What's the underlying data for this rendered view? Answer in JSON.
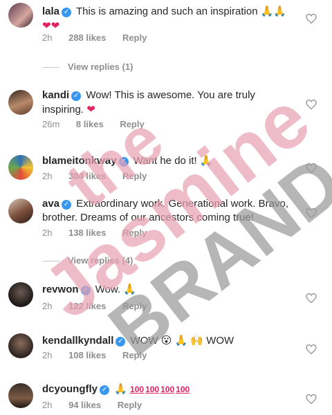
{
  "comments": [
    {
      "username": "lala",
      "text": "This is amazing and such an inspiration",
      "time": "2h",
      "likes": "288 likes",
      "reply": "Reply",
      "emoji": "🙏🙏 ❤❤"
    },
    {
      "username": "kandi",
      "text": "Wow! This is awesome. You are truly inspiring.",
      "time": "26m",
      "likes": "8 likes",
      "reply": "Reply",
      "emoji": "❤"
    },
    {
      "username": "blameitonkway",
      "text": "Want he do it!",
      "time": "2h",
      "likes": "384 likes",
      "reply": "Reply",
      "emoji": "🙏"
    },
    {
      "username": "ava",
      "text": "Extraordinary work. Generational work. Bravo, brother. Dreams of our ancestors coming true!",
      "time": "2h",
      "likes": "138 likes",
      "reply": "Reply"
    },
    {
      "username": "revwon",
      "text": "Wow.",
      "time": "2h",
      "likes": "122 likes",
      "reply": "Reply",
      "emoji": "🙏"
    },
    {
      "username": "kendallkyndall",
      "text": "WOW",
      "text2": "WOW",
      "time": "2h",
      "likes": "108 likes",
      "reply": "Reply",
      "emoji": "😮 🙏 🙌"
    },
    {
      "username": "dcyoungfly",
      "text": "",
      "time": "2h",
      "likes": "94 likes",
      "reply": "Reply",
      "emoji": "🙏 💯💯💯💯"
    }
  ],
  "view_replies": [
    "View replies (1)",
    "View replies (4)"
  ],
  "watermark": {
    "line1": "the",
    "line2": "Jasmine",
    "line3": "BRAND"
  },
  "icons": {
    "verified": "verified-badge-icon",
    "like": "heart-outline-icon"
  },
  "colors": {
    "verified": "#3897f0",
    "meta": "#8e8e8e",
    "watermark_pink": "#e8a1b4",
    "watermark_gray": "#9a9a9a"
  }
}
